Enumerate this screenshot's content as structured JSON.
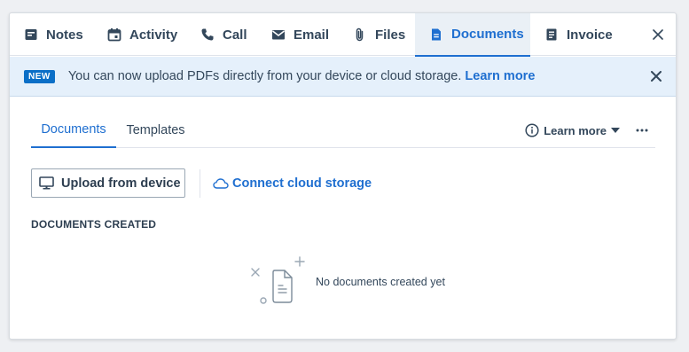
{
  "tabs": [
    {
      "label": "Notes",
      "icon": "notes-icon",
      "active": false
    },
    {
      "label": "Activity",
      "icon": "calendar-icon",
      "active": false
    },
    {
      "label": "Call",
      "icon": "phone-icon",
      "active": false
    },
    {
      "label": "Email",
      "icon": "envelope-icon",
      "active": false
    },
    {
      "label": "Files",
      "icon": "paperclip-icon",
      "active": false
    },
    {
      "label": "Documents",
      "icon": "document-icon",
      "active": true
    },
    {
      "label": "Invoice",
      "icon": "invoice-icon",
      "active": false
    }
  ],
  "banner": {
    "badge": "NEW",
    "text": "You can now upload PDFs directly from your device or cloud storage.",
    "link": "Learn more"
  },
  "subtabs": [
    {
      "label": "Documents",
      "active": true
    },
    {
      "label": "Templates",
      "active": false
    }
  ],
  "learn_more_menu": "Learn more",
  "actions": {
    "upload": "Upload from device",
    "cloud": "Connect cloud storage"
  },
  "section": {
    "heading": "DOCUMENTS CREATED",
    "empty_text": "No documents created yet"
  },
  "colors": {
    "accent": "#1f6fd0",
    "badge": "#0b6fc7",
    "banner_bg": "#e5f0fb",
    "active_tab_bg": "#eaf0f6",
    "text": "#33475b"
  }
}
